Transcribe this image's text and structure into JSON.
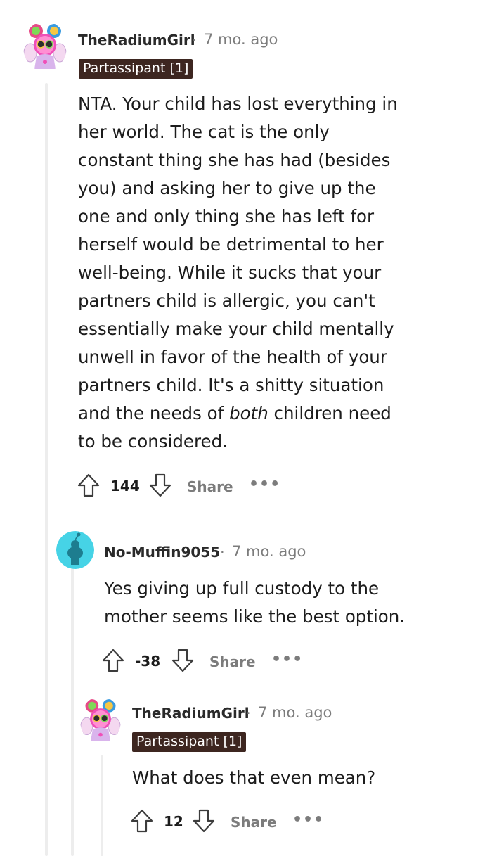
{
  "comments": [
    {
      "username": "TheRadiumGirl",
      "time": "7 mo. ago",
      "flair": "Partassipant [1]",
      "body": [
        {
          "text": "NTA. Your child has lost everything in"
        },
        {
          "text": "her world. The cat is the only"
        },
        {
          "text": "constant thing she has had (besides"
        },
        {
          "text": "you) and asking her to give up the"
        },
        {
          "text": "one and only thing she has left for"
        },
        {
          "text": "herself would be detrimental to her"
        },
        {
          "text": "well-being. While it sucks that your"
        },
        {
          "text": "partners child is allergic, you can't"
        },
        {
          "text": "essentially make your child mentally"
        },
        {
          "text": "unwell in favor of the health of your"
        },
        {
          "text": "partners child. It's a shitty situation"
        },
        {
          "pre": "and the needs of ",
          "em": "both",
          "post": " children need"
        },
        {
          "text": "to be considered."
        }
      ],
      "score": "144",
      "share": "Share",
      "more": "•••"
    },
    {
      "username": "No-Muffin9055",
      "time": "7 mo. ago",
      "body": [
        {
          "text": "Yes giving up full custody to the"
        },
        {
          "text": "mother seems like the best option."
        }
      ],
      "score": "-38",
      "share": "Share",
      "more": "•••"
    },
    {
      "username": "TheRadiumGirl",
      "time": "7 mo. ago",
      "flair": "Partassipant [1]",
      "body": [
        {
          "text": "What does that even mean?"
        }
      ],
      "score": "12",
      "share": "Share",
      "more": "•••"
    }
  ],
  "separator": "·",
  "icons": {
    "avatar_1": "radium-girl-avatar",
    "avatar_2": "default-snoo-avatar",
    "upvote": "upvote-arrow-icon",
    "downvote": "downvote-arrow-icon",
    "more": "more-options-icon"
  },
  "colors": {
    "flair_bg": "#3d2620",
    "snoo_bg": "#46d3e6",
    "meta": "#7c7c7c"
  }
}
